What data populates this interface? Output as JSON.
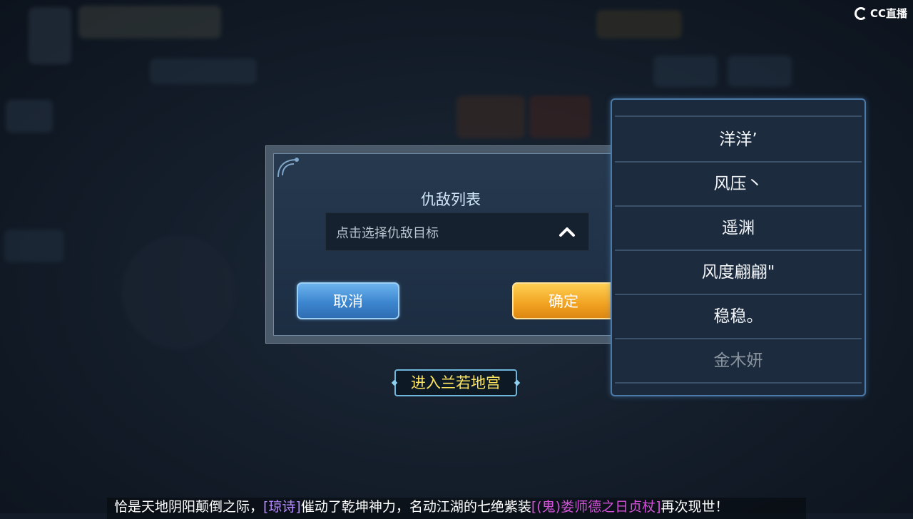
{
  "watermark": {
    "text": "CC直播"
  },
  "dialog": {
    "title": "仇敌列表",
    "select_placeholder": "点击选择仇敌目标",
    "cancel_label": "取消",
    "confirm_label": "确定"
  },
  "enter_palace": {
    "label": "进入兰若地宫"
  },
  "enemy_list": {
    "items": [
      {
        "name": "洋洋’"
      },
      {
        "name": "风压丶"
      },
      {
        "name": "遥渊"
      },
      {
        "name": "风度翩翩\""
      },
      {
        "name": "稳稳。"
      },
      {
        "name": "金木妍"
      }
    ]
  },
  "marquee": {
    "prefix": "恰是天地阴阳颠倒之际，",
    "user": "[琼诗]",
    "middle": "催动了乾坤神力，名动江湖的七绝紫装",
    "item": "[(鬼)娄师德之日贞杖]",
    "suffix": "再次现世！"
  },
  "colors": {
    "accent_blue": "#3c86cf",
    "accent_orange": "#f1a221",
    "highlight_yellow": "#ffe55f",
    "user_purple": "#b58cff",
    "item_magenta": "#d451d9"
  }
}
